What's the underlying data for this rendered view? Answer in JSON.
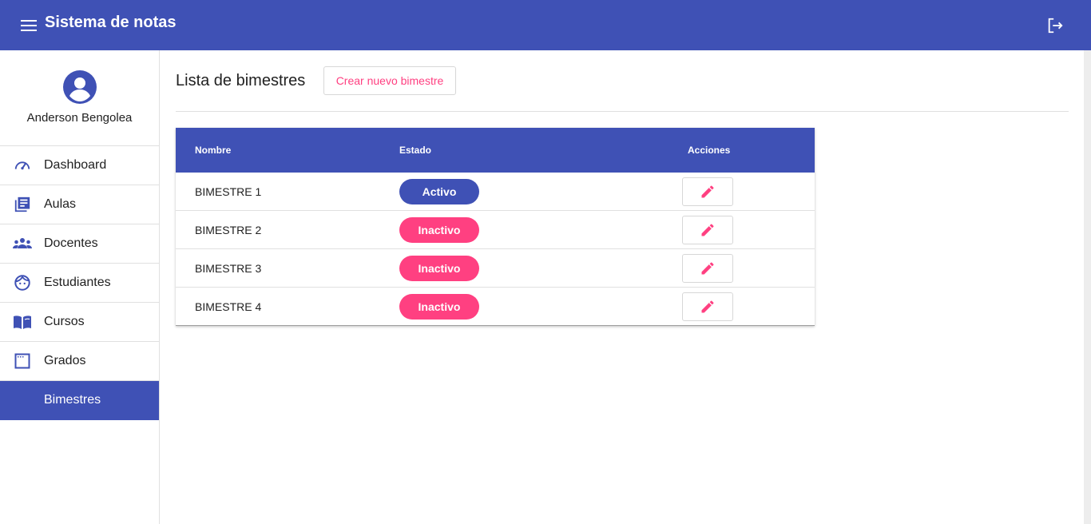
{
  "app": {
    "title": "Sistema de notas"
  },
  "colors": {
    "primary": "#3f51b5",
    "accent": "#ff4081"
  },
  "icons": {
    "menu": "menu-icon",
    "logout": "logout-icon",
    "avatar": "account-circle-icon"
  },
  "user": {
    "name": "Anderson Bengolea"
  },
  "sidebar": {
    "items": [
      {
        "label": "Dashboard",
        "icon": "speedometer-icon"
      },
      {
        "label": "Aulas",
        "icon": "library-books-icon"
      },
      {
        "label": "Docentes",
        "icon": "people-icon"
      },
      {
        "label": "Estudiantes",
        "icon": "face-icon"
      },
      {
        "label": "Cursos",
        "icon": "open-book-icon"
      },
      {
        "label": "Grados",
        "icon": "window-icon"
      },
      {
        "label": "Bimestres",
        "icon": "",
        "active": true
      }
    ]
  },
  "main": {
    "title": "Lista de bimestres",
    "create_label": "Crear nuevo bimestre",
    "table": {
      "headers": {
        "nombre": "Nombre",
        "estado": "Estado",
        "acciones": "Acciones"
      },
      "rows": [
        {
          "nombre": "BIMESTRE 1",
          "estado": "Activo"
        },
        {
          "nombre": "BIMESTRE 2",
          "estado": "Inactivo"
        },
        {
          "nombre": "BIMESTRE 3",
          "estado": "Inactivo"
        },
        {
          "nombre": "BIMESTRE 4",
          "estado": "Inactivo"
        }
      ]
    }
  }
}
